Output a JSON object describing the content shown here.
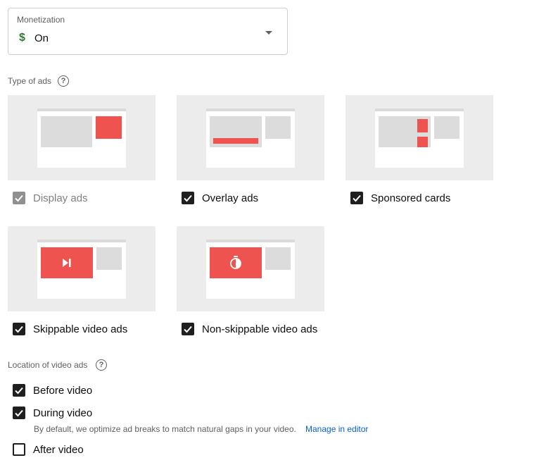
{
  "monetization": {
    "label": "Monetization",
    "value": "On",
    "icon": "dollar-icon",
    "icon_glyph": "$"
  },
  "ad_types": {
    "title": "Type of ads",
    "help_glyph": "?",
    "items": [
      {
        "label": "Display ads",
        "checked": true,
        "disabled": true
      },
      {
        "label": "Overlay ads",
        "checked": true,
        "disabled": false
      },
      {
        "label": "Sponsored cards",
        "checked": true,
        "disabled": false
      },
      {
        "label": "Skippable video ads",
        "checked": true,
        "disabled": false
      },
      {
        "label": "Non-skippable video ads",
        "checked": true,
        "disabled": false
      }
    ]
  },
  "locations": {
    "title": "Location of video ads",
    "help_glyph": "?",
    "items": [
      {
        "label": "Before video",
        "checked": true
      },
      {
        "label": "During video",
        "checked": true
      },
      {
        "label": "After video",
        "checked": false
      }
    ],
    "during_note": "By default, we optimize ad breaks to match natural gaps in your video.",
    "manage_link": "Manage in editor"
  },
  "colors": {
    "accent_red": "#ef5350",
    "link": "#065fd4",
    "dollar_green": "#2e7d32"
  }
}
